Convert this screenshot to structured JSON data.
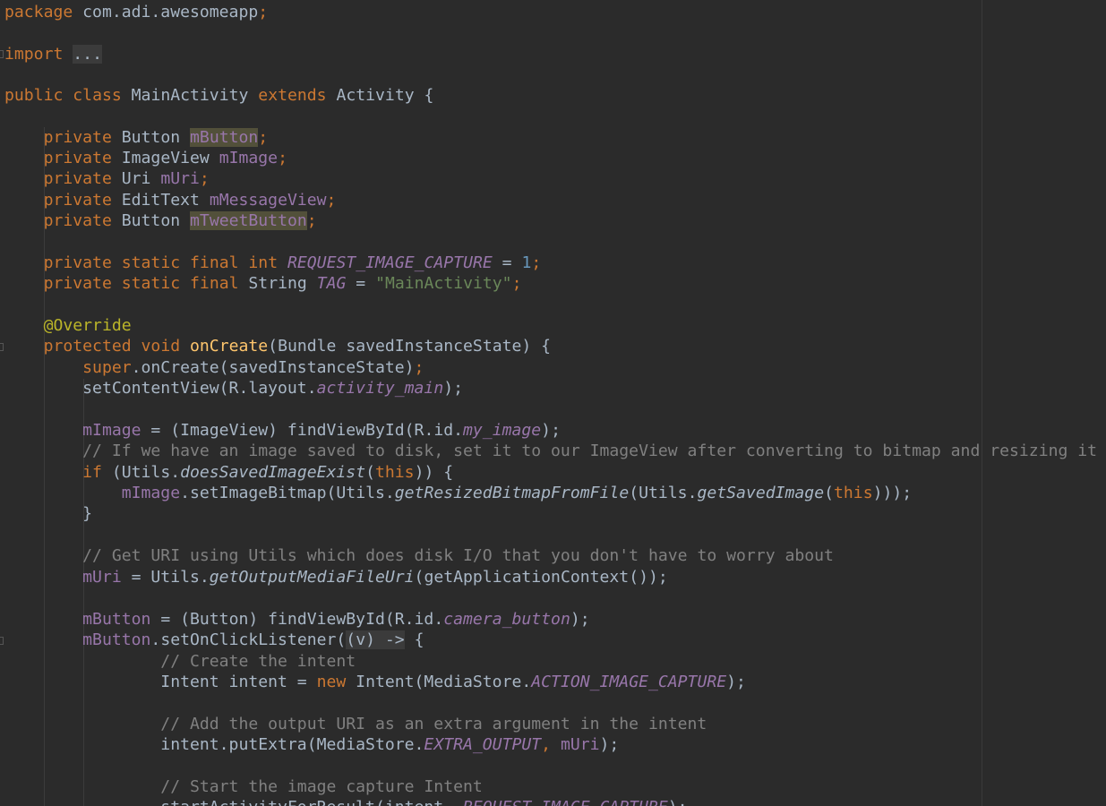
{
  "code": {
    "package_kw": "package",
    "package_name": " com.adi.awesomeapp",
    "semicolon": ";",
    "import_kw": "import",
    "import_fold": "...",
    "public_kw": "public",
    "class_kw": "class",
    "class_name": "MainActivity",
    "extends_kw": "extends",
    "parent_class": "Activity",
    "open_brace": "{",
    "private_kw": "private",
    "static_kw": "static",
    "final_kw": "final",
    "int_kw": "int",
    "type_button": "Button",
    "type_imageview": "ImageView",
    "type_uri": "Uri",
    "type_edittext": "EditText",
    "type_string": "String",
    "field_mbutton": "mButton",
    "field_mimage": "mImage",
    "field_muri": "mUri",
    "field_mmessageview": "mMessageView",
    "field_mtweetbutton": "mTweetButton",
    "const_request": "REQUEST_IMAGE_CAPTURE",
    "const_tag": "TAG",
    "num_one": "1",
    "str_mainactivity": "\"MainActivity\"",
    "annotation_override": "@Override",
    "protected_kw": "protected",
    "void_kw": "void",
    "method_oncreate": "onCreate",
    "oncreate_params": "(Bundle savedInstanceState) {",
    "super_kw": "super",
    "super_call": ".onCreate(savedInstanceState)",
    "set_content_view": "setContentView(R.layout.",
    "activity_main": "activity_main",
    "close_paren_semi": ");",
    "mimage_assign": " = (ImageView) findViewById(R.id.",
    "my_image": "my_image",
    "comment_disk": "// If we have an image saved to disk, set it to our ImageView after converting to bitmap and resizing it",
    "if_kw": "if",
    "utils_open": " (Utils.",
    "does_saved_image_exist": "doesSavedImageExist",
    "paren_open": "(",
    "this_kw": "this",
    "if_close": ")) {",
    "set_image_bitmap": ".setImageBitmap(Utils.",
    "get_resized": "getResizedBitmapFromFile",
    "utils_paren": "(Utils.",
    "get_saved_image": "getSavedImage",
    "triple_close": ")));",
    "close_brace": "}",
    "comment_uri": "// Get URI using Utils which does disk I/O that you don't have to worry about",
    "muri_assign": " = Utils.",
    "get_output_media": "getOutputMediaFileUri",
    "get_app_context": "(getApplicationContext());",
    "mbutton_assign": " = (Button) findViewById(R.id.",
    "camera_button": "camera_button",
    "set_on_click": ".setOnClickListener(",
    "lambda": "(v) ->",
    "space_brace": " {",
    "comment_create_intent": "// Create the intent",
    "intent_decl": "Intent intent = ",
    "new_kw": "new",
    "intent_ctor": " Intent(MediaStore.",
    "action_image_capture": "ACTION_IMAGE_CAPTURE",
    "comment_add_output": "// Add the output URI as an extra argument in the intent",
    "put_extra": "intent.putExtra(MediaStore.",
    "extra_output": "EXTRA_OUTPUT",
    "comma_space": ", ",
    "comment_start_capture": "// Start the image capture Intent",
    "start_activity": "startActivityForResult(intent, "
  },
  "colors": {
    "background": "#2b2b2b",
    "default_text": "#a9b7c6",
    "keyword": "#cc7832",
    "annotation": "#bbb529",
    "field": "#9876aa",
    "string": "#6a8759",
    "number": "#6897bb",
    "comment": "#808080",
    "method": "#ffc66d"
  }
}
